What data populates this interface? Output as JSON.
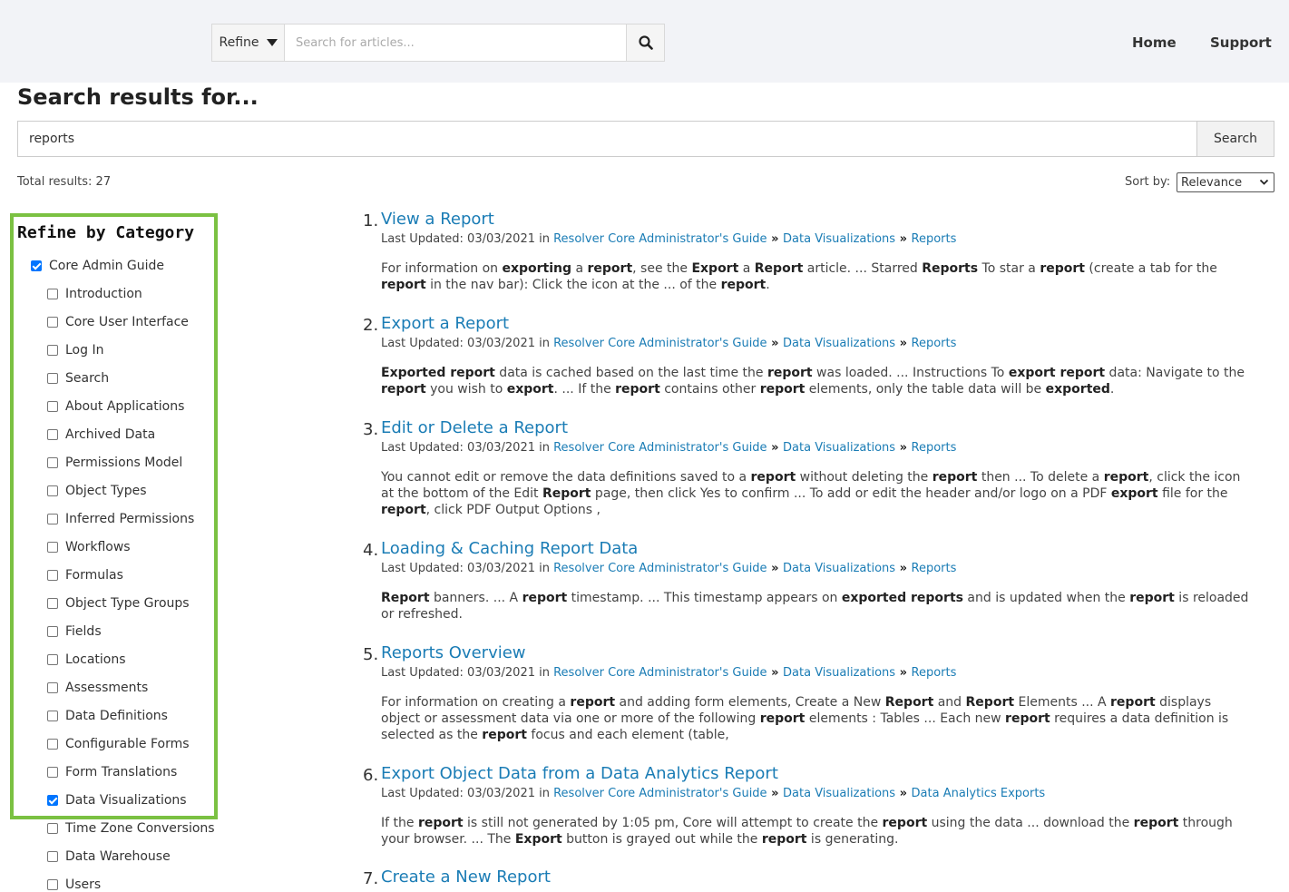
{
  "topbar": {
    "refine_label": "Refine",
    "search_placeholder": "Search for articles...",
    "nav": [
      "Home",
      "Support"
    ]
  },
  "header": {
    "title": "Search results for...",
    "query": "reports",
    "search_button": "Search",
    "total": "Total results: 27",
    "sort_label": "Sort by:",
    "sort_value": "Relevance"
  },
  "sidebar": {
    "title": "Refine by Category",
    "parent": {
      "label": "Core Admin Guide",
      "checked": true
    },
    "items": [
      {
        "label": "Introduction",
        "checked": false
      },
      {
        "label": "Core User Interface",
        "checked": false
      },
      {
        "label": "Log In",
        "checked": false
      },
      {
        "label": "Search",
        "checked": false
      },
      {
        "label": "About Applications",
        "checked": false
      },
      {
        "label": "Archived Data",
        "checked": false
      },
      {
        "label": "Permissions Model",
        "checked": false
      },
      {
        "label": "Object Types",
        "checked": false
      },
      {
        "label": "Inferred Permissions",
        "checked": false
      },
      {
        "label": "Workflows",
        "checked": false
      },
      {
        "label": "Formulas",
        "checked": false
      },
      {
        "label": "Object Type Groups",
        "checked": false
      },
      {
        "label": "Fields",
        "checked": false
      },
      {
        "label": "Locations",
        "checked": false
      },
      {
        "label": "Assessments",
        "checked": false
      },
      {
        "label": "Data Definitions",
        "checked": false
      },
      {
        "label": "Configurable Forms",
        "checked": false
      },
      {
        "label": "Form Translations",
        "checked": false
      },
      {
        "label": "Data Visualizations",
        "checked": true
      },
      {
        "label": "Time Zone Conversions",
        "checked": false
      },
      {
        "label": "Data Warehouse",
        "checked": false
      },
      {
        "label": "Users",
        "checked": false
      }
    ]
  },
  "results": [
    {
      "num": "1.",
      "title": "View a Report",
      "updated": "Last Updated: 03/03/2021 in",
      "crumbs": [
        "Resolver Core Administrator's Guide",
        "Data Visualizations",
        "Reports"
      ],
      "snippet": "For information on <b>exporting</b> a <b>report</b>, see the <b>Export</b> a <b>Report</b> article. ... Starred <b>Reports</b> To star a <b>report</b> (create a tab for the <b>report</b> in the nav bar): Click the  icon at the ... of the <b>report</b>."
    },
    {
      "num": "2.",
      "title": "Export a Report",
      "updated": "Last Updated: 03/03/2021 in",
      "crumbs": [
        "Resolver Core Administrator's Guide",
        "Data Visualizations",
        "Reports"
      ],
      "snippet": "<b>Exported report</b> data is cached based on the last time the <b>report</b> was loaded. ... Instructions To <b>export report</b> data: Navigate to the <b>report</b> you wish to <b>export</b>. ... If the <b>report</b> contains other <b>report</b> elements, only the table data will be <b>exported</b>."
    },
    {
      "num": "3.",
      "title": "Edit or Delete a Report",
      "updated": "Last Updated: 03/03/2021 in",
      "crumbs": [
        "Resolver Core Administrator's Guide",
        "Data Visualizations",
        "Reports"
      ],
      "snippet": "You  cannot edit or remove the data definitions saved to a <b>report</b> without deleting the <b>report</b> then ... To delete a <b>report</b>, click the  icon at the bottom of the Edit <b>Report</b>  page, then click Yes  to confirm ... To add or edit the header and/or logo on a PDF <b>export</b> file for the <b>report</b>, click PDF Output Options ,"
    },
    {
      "num": "4.",
      "title": "Loading & Caching Report Data",
      "updated": "Last Updated: 03/03/2021 in",
      "crumbs": [
        "Resolver Core Administrator's Guide",
        "Data Visualizations",
        "Reports"
      ],
      "snippet": "<b>Report</b> banners.   ... A <b>report</b> timestamp.   ... This timestamp appears on <b>exported reports</b> and is updated when the <b>report</b> is reloaded or refreshed."
    },
    {
      "num": "5.",
      "title": "Reports Overview",
      "updated": "Last Updated: 03/03/2021 in",
      "crumbs": [
        "Resolver Core Administrator's Guide",
        "Data Visualizations",
        "Reports"
      ],
      "snippet": "For information on creating a <b>report</b> and adding form elements, Create a New <b>Report</b> and <b>Report</b> Elements ... A <b>report</b> displays object or assessment data via one or more of the following <b>report</b> elements : Tables ... Each new <b>report</b> requires a data definition is selected as the <b>report</b> focus and each element (table,"
    },
    {
      "num": "6.",
      "title": "Export Object Data from a Data Analytics Report",
      "updated": "Last Updated: 03/03/2021 in",
      "crumbs": [
        "Resolver Core Administrator's Guide",
        "Data Visualizations",
        "Data Analytics Exports"
      ],
      "snippet": "If the <b>report</b> is still not generated by 1:05 pm, Core will attempt to create the <b>report</b> using the data ... download the <b>report</b> through your browser. ... The <b>Export</b>  button is grayed out while the <b>report</b> is generating."
    },
    {
      "num": "7.",
      "title": "Create a New Report",
      "updated": "",
      "crumbs": [],
      "snippet": ""
    }
  ]
}
